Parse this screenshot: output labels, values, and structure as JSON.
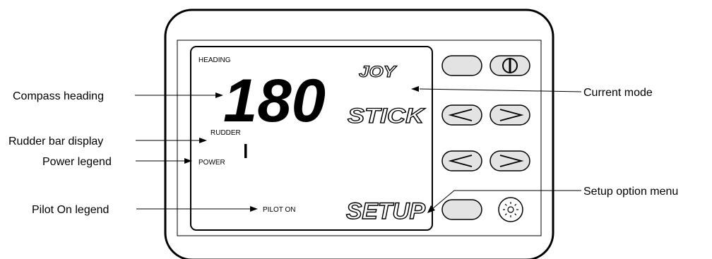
{
  "callouts": {
    "compass_heading": "Compass heading",
    "rudder_bar_display": "Rudder bar display",
    "power_legend": "Power legend",
    "pilot_on_legend": "Pilot On legend",
    "current_mode": "Current mode",
    "setup_option_menu": "Setup option menu"
  },
  "display": {
    "heading_label": "HEADING",
    "heading_value": "180",
    "mode_line1": "JOY",
    "mode_line2": "STICK",
    "rudder_label": "RUDDER",
    "power_label": "POWER",
    "pilot_on_label": "PILOT ON",
    "menu_value": "SETUP"
  },
  "buttons": {
    "left_arrow": "<",
    "right_arrow": ">"
  },
  "icons": {
    "power": "power-icon",
    "backlight": "sun-icon"
  }
}
